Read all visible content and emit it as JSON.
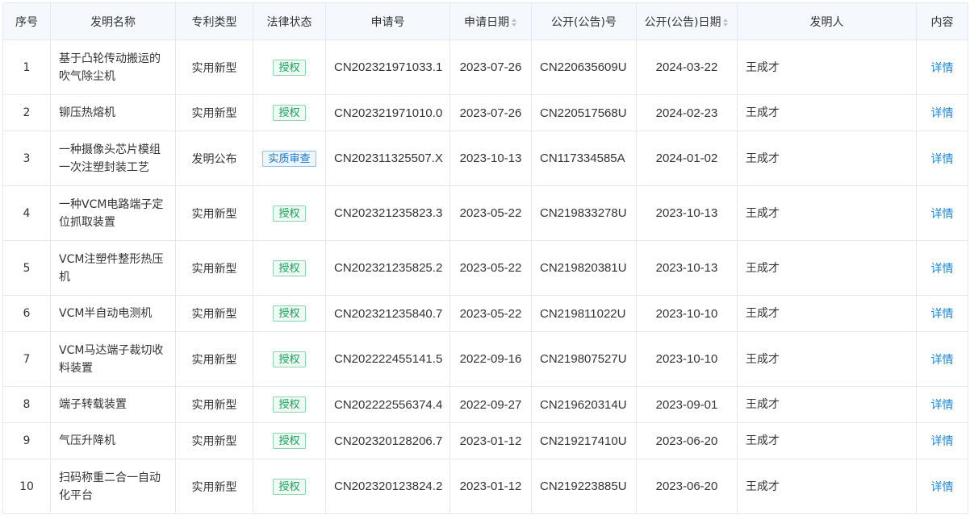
{
  "columns": {
    "no": "序号",
    "name": "发明名称",
    "type": "专利类型",
    "status": "法律状态",
    "app_no": "申请号",
    "app_date": "申请日期",
    "pub_no": "公开(公告)号",
    "pub_date": "公开(公告)日期",
    "inventor": "发明人",
    "content": "内容"
  },
  "sortable_columns": [
    "申请日期",
    "公开(公告)日期"
  ],
  "status_colors": {
    "授权": "#12a15b",
    "实质审查": "#1677c9"
  },
  "link_color": "#1d85d0",
  "header_bg": "#f5f8fd",
  "rows": [
    {
      "no": "1",
      "name": "基于凸轮传动搬运的吹气除尘机",
      "type": "实用新型",
      "status": "授权",
      "status_kind": "green",
      "app_no": "CN202321971033.1",
      "app_date": "2023-07-26",
      "pub_no": "CN220635609U",
      "pub_date": "2024-03-22",
      "inventor": "王成才",
      "link": "详情"
    },
    {
      "no": "2",
      "name": "铆压热熔机",
      "type": "实用新型",
      "status": "授权",
      "status_kind": "green",
      "app_no": "CN202321971010.0",
      "app_date": "2023-07-26",
      "pub_no": "CN220517568U",
      "pub_date": "2024-02-23",
      "inventor": "王成才",
      "link": "详情"
    },
    {
      "no": "3",
      "name": "一种摄像头芯片模组一次注塑封装工艺",
      "type": "发明公布",
      "status": "实质审查",
      "status_kind": "blue",
      "app_no": "CN202311325507.X",
      "app_date": "2023-10-13",
      "pub_no": "CN117334585A",
      "pub_date": "2024-01-02",
      "inventor": "王成才",
      "link": "详情"
    },
    {
      "no": "4",
      "name": "一种VCM电路端子定位抓取装置",
      "type": "实用新型",
      "status": "授权",
      "status_kind": "green",
      "app_no": "CN202321235823.3",
      "app_date": "2023-05-22",
      "pub_no": "CN219833278U",
      "pub_date": "2023-10-13",
      "inventor": "王成才",
      "link": "详情"
    },
    {
      "no": "5",
      "name": "VCM注塑件整形热压机",
      "type": "实用新型",
      "status": "授权",
      "status_kind": "green",
      "app_no": "CN202321235825.2",
      "app_date": "2023-05-22",
      "pub_no": "CN219820381U",
      "pub_date": "2023-10-13",
      "inventor": "王成才",
      "link": "详情"
    },
    {
      "no": "6",
      "name": "VCM半自动电测机",
      "type": "实用新型",
      "status": "授权",
      "status_kind": "green",
      "app_no": "CN202321235840.7",
      "app_date": "2023-05-22",
      "pub_no": "CN219811022U",
      "pub_date": "2023-10-10",
      "inventor": "王成才",
      "link": "详情"
    },
    {
      "no": "7",
      "name": "VCM马达端子裁切收料装置",
      "type": "实用新型",
      "status": "授权",
      "status_kind": "green",
      "app_no": "CN202222455141.5",
      "app_date": "2022-09-16",
      "pub_no": "CN219807527U",
      "pub_date": "2023-10-10",
      "inventor": "王成才",
      "link": "详情"
    },
    {
      "no": "8",
      "name": "端子转载装置",
      "type": "实用新型",
      "status": "授权",
      "status_kind": "green",
      "app_no": "CN202222556374.4",
      "app_date": "2022-09-27",
      "pub_no": "CN219620314U",
      "pub_date": "2023-09-01",
      "inventor": "王成才",
      "link": "详情"
    },
    {
      "no": "9",
      "name": "气压升降机",
      "type": "实用新型",
      "status": "授权",
      "status_kind": "green",
      "app_no": "CN202320128206.7",
      "app_date": "2023-01-12",
      "pub_no": "CN219217410U",
      "pub_date": "2023-06-20",
      "inventor": "王成才",
      "link": "详情"
    },
    {
      "no": "10",
      "name": "扫码称重二合一自动化平台",
      "type": "实用新型",
      "status": "授权",
      "status_kind": "green",
      "app_no": "CN202320123824.2",
      "app_date": "2023-01-12",
      "pub_no": "CN219223885U",
      "pub_date": "2023-06-20",
      "inventor": "王成才",
      "link": "详情"
    }
  ]
}
